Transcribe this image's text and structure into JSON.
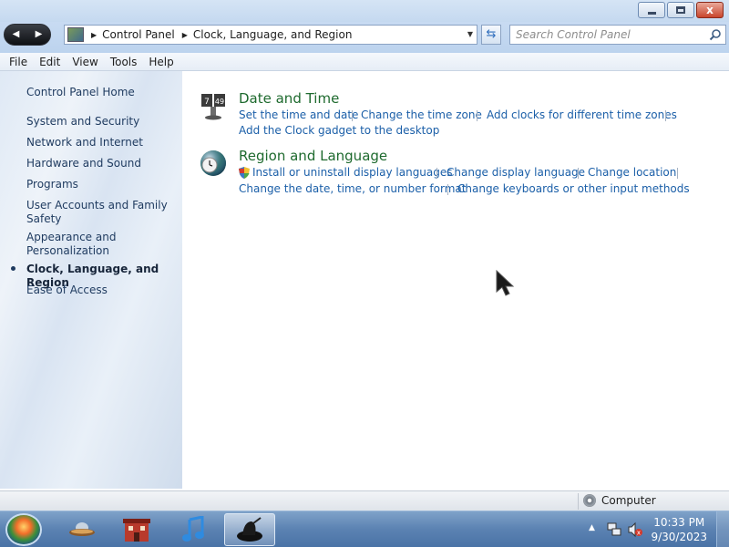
{
  "window": {
    "caption_buttons": [
      "minimize-icon",
      "maximize-icon",
      "close-icon"
    ],
    "close_glyph": "x"
  },
  "nav": {
    "back_glyph": "◀",
    "forward_glyph": "▶",
    "breadcrumb": [
      "Control Panel",
      "Clock, Language, and Region"
    ],
    "search_placeholder": "Search Control Panel"
  },
  "menu": [
    "File",
    "Edit",
    "View",
    "Tools",
    "Help"
  ],
  "sidebar": {
    "home": "Control Panel Home",
    "items": [
      {
        "label": "System and Security",
        "lines": [
          "System and Security"
        ]
      },
      {
        "label": "Network and Internet",
        "lines": [
          "Network and Internet"
        ]
      },
      {
        "label": "Hardware and Sound",
        "lines": [
          "Hardware and Sound"
        ]
      },
      {
        "label": "Programs",
        "lines": [
          "Programs"
        ]
      },
      {
        "label": "User Accounts and Family Safety",
        "lines": [
          "User Accounts and Family",
          "Safety"
        ]
      },
      {
        "label": "Appearance and Personalization",
        "lines": [
          "Appearance and",
          "Personalization"
        ]
      },
      {
        "label": "Clock, Language, and Region",
        "lines": [
          "Clock, Language, and Region"
        ],
        "selected": true
      },
      {
        "label": "Ease of Access",
        "lines": [
          "Ease of Access"
        ]
      }
    ]
  },
  "categories": [
    {
      "title": "Date and Time",
      "icon": "clock-calendar-icon",
      "links": [
        "Set the time and date",
        "Change the time zone",
        "Add clocks for different time zones",
        "Add the Clock gadget to the desktop"
      ]
    },
    {
      "title": "Region and Language",
      "icon": "globe-clock-icon",
      "links": [
        "Install or uninstall display languages",
        "Change display language",
        "Change location",
        "Change the date, time, or number format",
        "Change keyboards or other input methods"
      ]
    }
  ],
  "statusbar": {
    "location": "Computer"
  },
  "taskbar": {
    "apps": [
      "ufo-app-icon",
      "red-building-app-icon",
      "music-note-app-icon",
      "black-hat-app-icon"
    ],
    "active_app": "black-hat-app-icon",
    "time": "10:33 PM",
    "date": "9/30/2023"
  },
  "colors": {
    "link": "#1b5fa8",
    "category_title": "#1e6a2e",
    "taskbar": "#5b82b2"
  }
}
